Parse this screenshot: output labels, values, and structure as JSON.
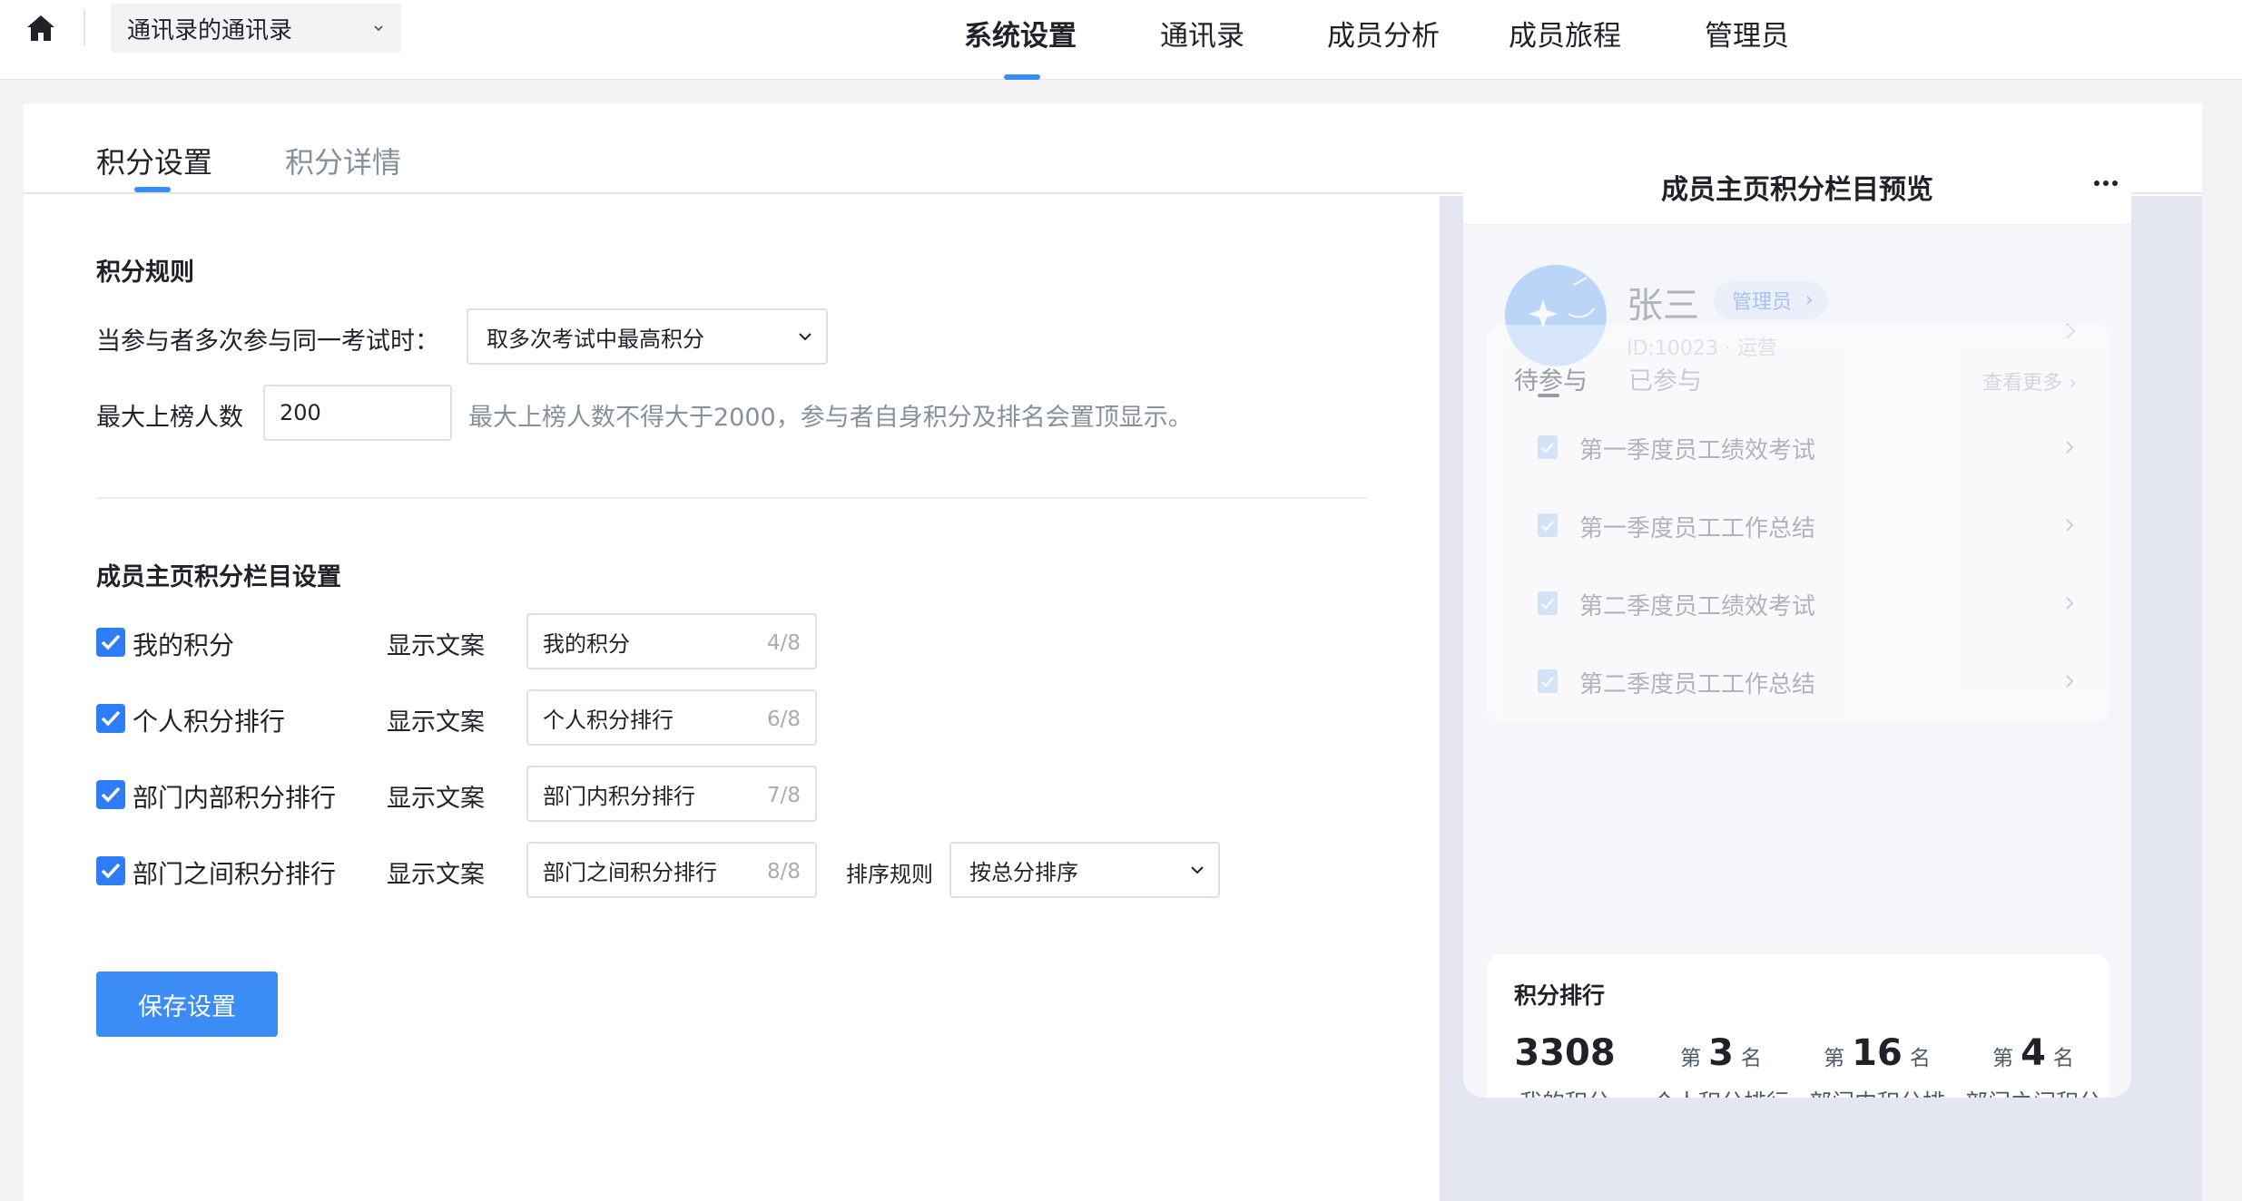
{
  "topnav": {
    "org_name": "通讯录的通讯录",
    "tabs": [
      "系统设置",
      "通讯录",
      "成员分析",
      "成员旅程",
      "管理员"
    ]
  },
  "subtabs": [
    "积分设置",
    "积分详情"
  ],
  "rules": {
    "title": "积分规则",
    "repeat_label": "当参与者多次参与同一考试时：",
    "repeat_value": "取多次考试中最高积分",
    "max_label": "最大上榜人数",
    "max_value": "200",
    "max_hint": "最大上榜人数不得大于2000，参与者自身积分及排名会置顶显示。"
  },
  "columns": {
    "title": "成员主页积分栏目设置",
    "show_label": "显示文案",
    "items": [
      {
        "label": "我的积分",
        "text": "我的积分",
        "count": "4/8",
        "checked": true
      },
      {
        "label": "个人积分排行",
        "text": "个人积分排行",
        "count": "6/8",
        "checked": true
      },
      {
        "label": "部门内部积分排行",
        "text": "部门内积分排行",
        "count": "7/8",
        "checked": true
      },
      {
        "label": "部门之间积分排行",
        "text": "部门之间积分排行",
        "count": "8/8",
        "checked": true
      }
    ],
    "sort_label": "排序规则",
    "sort_value": "按总分排序"
  },
  "save_label": "保存设置",
  "preview": {
    "title": "成员主页积分栏目预览",
    "user": {
      "name": "张三",
      "role": "管理员",
      "meta": "ID:10023 · 运营"
    },
    "tabs": [
      "待参与",
      "已参与"
    ],
    "view_more": "查看更多",
    "tasks": [
      "第一季度员工绩效考试",
      "第一季度员工工作总结",
      "第二季度员工绩效考试",
      "第二季度员工工作总结"
    ],
    "ranking": {
      "title": "积分排行",
      "my_points": "3308",
      "prefix": "第",
      "suffix": "名",
      "personal_rank": "3",
      "dept_inner_rank": "16",
      "dept_between_rank": "4",
      "labels": [
        "我的积分",
        "个人积分排行",
        "部门内积分排行",
        "部门之间积分排行"
      ]
    }
  },
  "colors": {
    "accent": "#3b8cf5",
    "checkbox": "#2f7df6"
  }
}
